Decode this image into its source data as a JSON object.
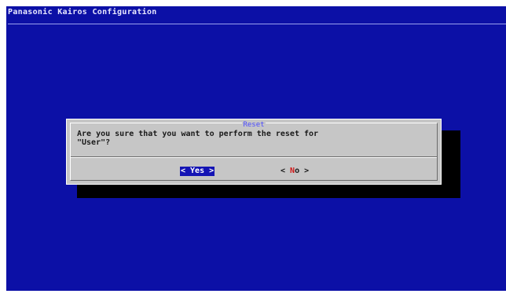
{
  "app": {
    "backtitle": "Panasonic Kairos Configuration"
  },
  "dialog": {
    "title": "Reset",
    "message": "Are you sure that you want to perform the reset for\n\"User\"?",
    "buttons": {
      "yes": {
        "label": "< Yes >",
        "selected": true
      },
      "no": {
        "open": "< ",
        "hotkey": "N",
        "rest": "o >",
        "selected": false
      }
    }
  },
  "colors": {
    "background": "#0c10a6",
    "dialog": "#c6c6c6",
    "shadow": "#000000",
    "selected_button": "#1414b4",
    "hotkey": "#d01818",
    "title": "#4a4aff"
  }
}
